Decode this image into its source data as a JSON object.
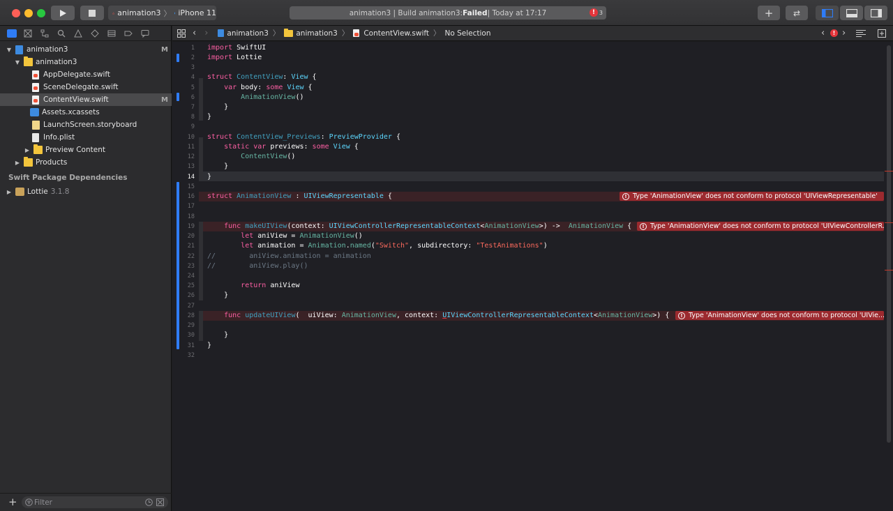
{
  "toolbar": {
    "scheme_target": "animation3",
    "scheme_device": "iPhone 11",
    "status_prefix": "animation3 | Build animation3: ",
    "status_result": "Failed",
    "status_suffix": " | Today at 17:17",
    "error_count": "3"
  },
  "navigator": {
    "project": "animation3",
    "project_badge": "M",
    "group": "animation3",
    "files": [
      {
        "label": "AppDelegate.swift"
      },
      {
        "label": "SceneDelegate.swift"
      },
      {
        "label": "ContentView.swift",
        "badge": "M"
      },
      {
        "label": "Assets.xcassets"
      },
      {
        "label": "LaunchScreen.storyboard"
      },
      {
        "label": "Info.plist"
      },
      {
        "label": "Preview Content"
      }
    ],
    "products": "Products",
    "packages_header": "Swift Package Dependencies",
    "package_name": "Lottie",
    "package_version": "3.1.8",
    "filter_placeholder": "Filter"
  },
  "jumpbar": {
    "crumbs": [
      "animation3",
      "animation3",
      "ContentView.swift",
      "No Selection"
    ]
  },
  "editor": {
    "lines": [
      "1",
      "2",
      "3",
      "4",
      "5",
      "6",
      "7",
      "8",
      "9",
      "10",
      "11",
      "12",
      "13",
      "14",
      "15",
      "16",
      "17",
      "18",
      "19",
      "20",
      "21",
      "22",
      "23",
      "24",
      "25",
      "26",
      "27",
      "28",
      "29",
      "30",
      "31",
      "32"
    ],
    "current_line": "14",
    "errors": [
      "Type 'AnimationView' does not conform to protocol 'UIViewRepresentable'",
      "Type 'AnimationView' does not conform to protocol 'UIViewControllerR...",
      "Type 'AnimationView' does not conform to protocol 'UIVie..."
    ]
  },
  "colors": {
    "accent": "#2f7cf6",
    "error": "#9c2a2f",
    "keyword": "#fc5fa3",
    "type": "#5dd8ff"
  },
  "icons": [
    "run-icon",
    "stop-icon",
    "xcode-icon",
    "iphone-icon",
    "add-icon",
    "swap-icon",
    "layout-icon",
    "folder-icon",
    "swift-file-icon",
    "filter-icon",
    "error-icon"
  ]
}
